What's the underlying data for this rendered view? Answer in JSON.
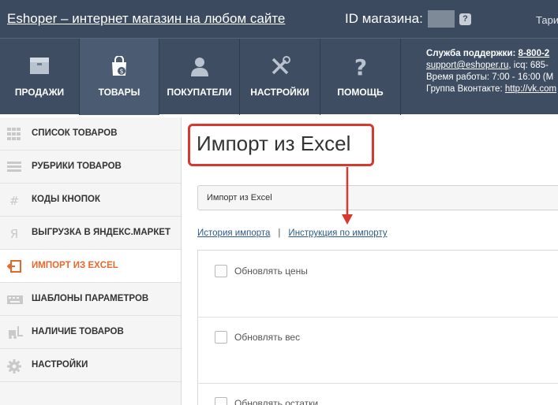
{
  "header": {
    "site_title": "Eshoper – интернет магазин на любом сайте",
    "shop_id_label": "ID магазина:",
    "help_icon_glyph": "?",
    "tariff_label": "Тари"
  },
  "nav": {
    "tabs": [
      {
        "label": "ПРОДАЖИ",
        "icon": "box-icon"
      },
      {
        "label": "ТОВАРЫ",
        "icon": "shopping-bag-icon",
        "active": true
      },
      {
        "label": "ПОКУПАТЕЛИ",
        "icon": "user-icon"
      },
      {
        "label": "НАСТРОЙКИ",
        "icon": "tools-icon"
      },
      {
        "label": "ПОМОЩЬ",
        "icon": "question-icon"
      }
    ],
    "support": {
      "line1_label": "Служба поддержки:",
      "line1_phone": "8-800-2",
      "email": "support@eshoper.ru",
      "icq_text": ", icq: 685-",
      "hours": "Время работы: 7:00 - 16:00 (М",
      "vk_label": "Группа Вконтакте:",
      "vk_link": "http://vk.com"
    }
  },
  "sidebar": {
    "items": [
      {
        "label": "СПИСОК ТОВАРОВ",
        "icon": "grid-icon"
      },
      {
        "label": "РУБРИКИ ТОВАРОВ",
        "icon": "list-icon"
      },
      {
        "label": "КОДЫ КНОПОК",
        "icon": "hash-icon"
      },
      {
        "label": "ВЫГРУЗКА В ЯНДЕКС.МАРКЕТ",
        "icon": "yandex-icon"
      },
      {
        "label": "ИМПОРТ ИЗ EXCEL",
        "icon": "import-icon",
        "active": true
      },
      {
        "label": "ШАБЛОНЫ ПАРАМЕТРОВ",
        "icon": "keyboard-icon"
      },
      {
        "label": "НАЛИЧИЕ ТОВАРОВ",
        "icon": "forklift-icon"
      },
      {
        "label": "НАСТРОЙКИ",
        "icon": "gear-icon"
      }
    ]
  },
  "main": {
    "title": "Импорт из Excel",
    "breadcrumb": "Импорт из Excel",
    "links": {
      "history": "История импорта",
      "separator": "|",
      "instructions": "Инструкция по импорту"
    },
    "options": [
      {
        "label": "Обновлять цены",
        "checked": false
      },
      {
        "label": "Обновлять вес",
        "checked": false
      },
      {
        "label": "Обновлять остатки",
        "checked": false
      }
    ]
  },
  "colors": {
    "header_bg": "#3b4a5e",
    "accent_orange": "#e9672a",
    "highlight_red": "#d9382e",
    "link_blue": "#2c5a8c"
  }
}
